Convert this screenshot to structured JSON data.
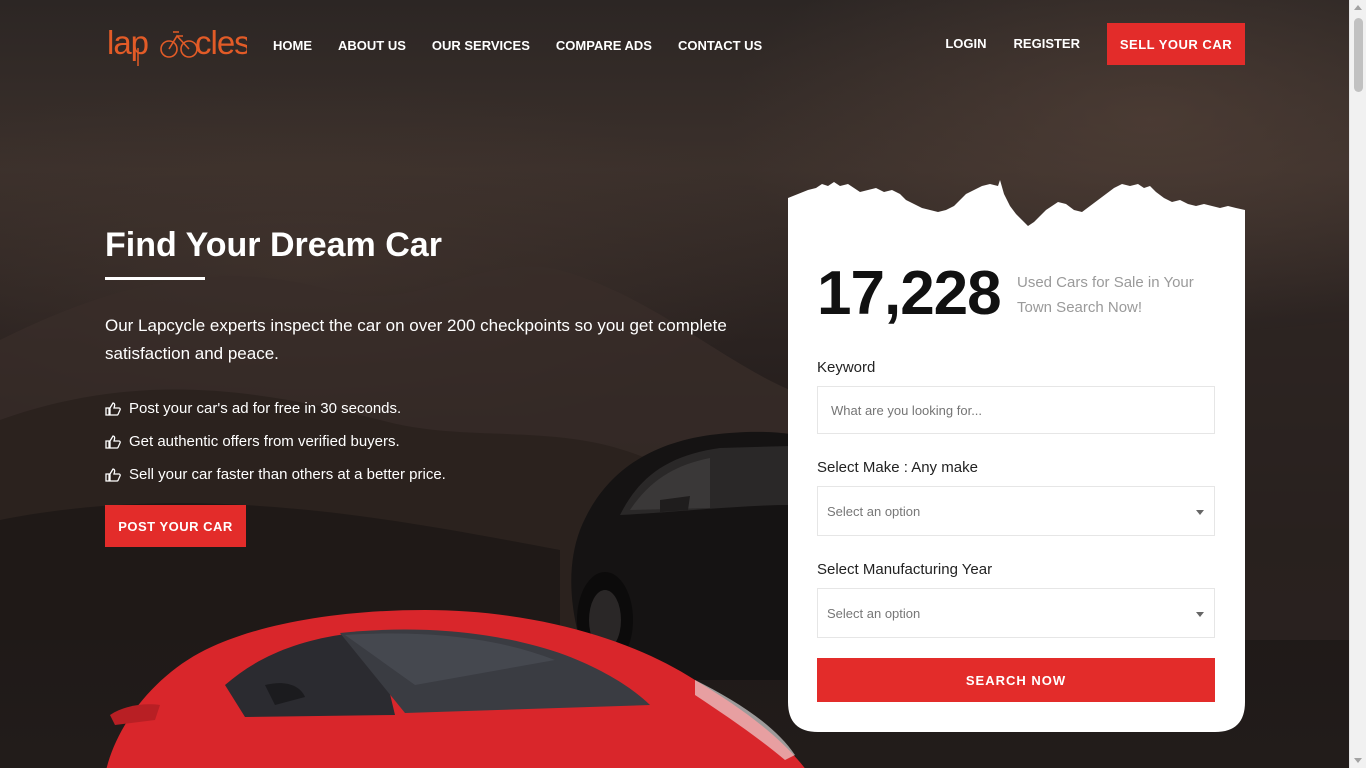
{
  "brand": {
    "logo_text": "lapcycles",
    "accent": "#e25b27",
    "primary_red": "#e32c2a"
  },
  "nav": {
    "items": [
      {
        "label": "HOME"
      },
      {
        "label": "ABOUT US"
      },
      {
        "label": "OUR SERVICES"
      },
      {
        "label": "COMPARE ADS"
      },
      {
        "label": "CONTACT US"
      }
    ],
    "login": "LOGIN",
    "register": "REGISTER",
    "sell_button": "SELL YOUR CAR"
  },
  "hero": {
    "title": "Find Your Dream Car",
    "description": "Our Lapcycle experts inspect the car on over 200 checkpoints so you get complete satisfaction and peace.",
    "features": [
      {
        "text": "Post your car's ad for free in 30 seconds.",
        "icon": "thumbs-up-icon"
      },
      {
        "text": "Get authentic offers from verified buyers.",
        "icon": "thumbs-up-icon"
      },
      {
        "text": "Sell your car faster than others at a better price.",
        "icon": "thumbs-up-icon"
      }
    ],
    "post_button": "POST YOUR CAR"
  },
  "search_card": {
    "count": "17,228",
    "count_label": "Used Cars for Sale in Your Town Search Now!",
    "keyword_label": "Keyword",
    "keyword_placeholder": "What are you looking for...",
    "make_label": "Select Make : Any make",
    "make_value": "Select an option",
    "year_label": "Select Manufacturing Year",
    "year_value": "Select an option",
    "search_button": "SEARCH NOW"
  }
}
